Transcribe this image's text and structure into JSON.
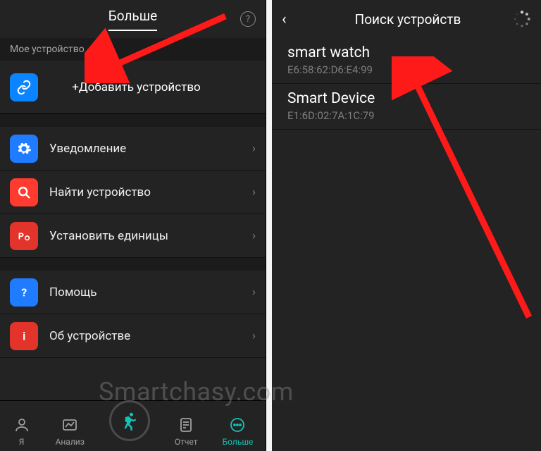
{
  "left": {
    "header": {
      "title": "Больше",
      "help_glyph": "?"
    },
    "section_label": "Мое устройство",
    "add_device_label": "+Добавить устройство",
    "rows": [
      {
        "label": "Уведомление"
      },
      {
        "label": "Найти устройство"
      },
      {
        "label": "Установить единицы"
      }
    ],
    "rows2": [
      {
        "label": "Помощь"
      },
      {
        "label": "Об устройстве"
      }
    ],
    "tabs": {
      "me": "Я",
      "analysis": "Анализ",
      "report": "Отчет",
      "more": "Больше"
    }
  },
  "right": {
    "header": {
      "title": "Поиск устройств"
    },
    "devices": [
      {
        "name": "smart watch",
        "mac": "E6:58:62:D6:E4:99"
      },
      {
        "name": "Smart Device",
        "mac": "E1:6D:02:7A:1C:79"
      }
    ]
  },
  "watermark": "Smartchasy.com",
  "chevron": "›",
  "back_glyph": "‹",
  "colors": {
    "accent": "#14c3b5",
    "arrow": "#ff1a1a"
  }
}
